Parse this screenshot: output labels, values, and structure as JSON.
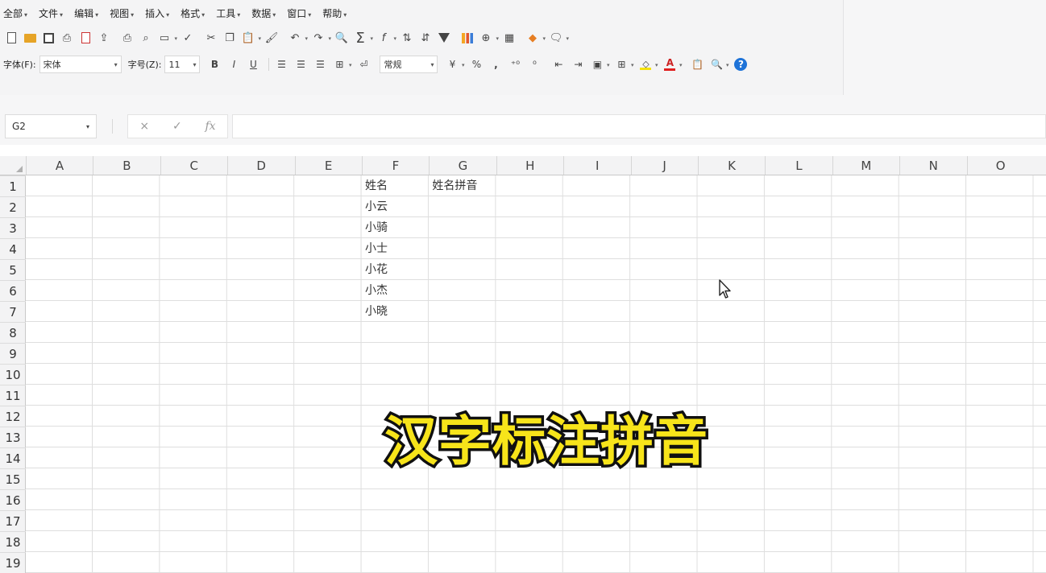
{
  "menu": [
    {
      "label": "全部"
    },
    {
      "label": "文件"
    },
    {
      "label": "编辑"
    },
    {
      "label": "视图"
    },
    {
      "label": "插入"
    },
    {
      "label": "格式"
    },
    {
      "label": "工具"
    },
    {
      "label": "数据"
    },
    {
      "label": "窗口"
    },
    {
      "label": "帮助"
    }
  ],
  "format_toolbar": {
    "font_label": "字体(F):",
    "font_value": "宋体",
    "size_label": "字号(Z):",
    "size_value": "11",
    "bold": "B",
    "italic": "I",
    "underline": "U",
    "number_format": "常规",
    "percent": "%",
    "comma": ","
  },
  "formula_bar": {
    "name_box": "G2",
    "cancel": "×",
    "confirm": "✓",
    "fx": "fx",
    "content": ""
  },
  "columns": [
    "A",
    "B",
    "C",
    "D",
    "E",
    "F",
    "G",
    "H",
    "I",
    "J",
    "K",
    "L",
    "M",
    "N",
    "O"
  ],
  "rows": [
    "1",
    "2",
    "3",
    "4",
    "5",
    "6",
    "7",
    "8",
    "9",
    "10",
    "11",
    "12",
    "13",
    "14",
    "15",
    "16",
    "17",
    "18",
    "19"
  ],
  "cells": {
    "F1": "姓名",
    "G1": "姓名拼音",
    "F2": "小云",
    "F3": "小骑",
    "F4": "小士",
    "F5": "小花",
    "F6": "小杰",
    "F7": "小晓"
  },
  "caption": "汉字标注拼音",
  "icons": [
    "new-doc-icon",
    "open-folder-icon",
    "save-icon",
    "sum-icon",
    "filter-icon",
    "chart-icon",
    "help-icon",
    "fill-color-icon",
    "font-color-icon",
    "mouse-cursor-icon"
  ]
}
